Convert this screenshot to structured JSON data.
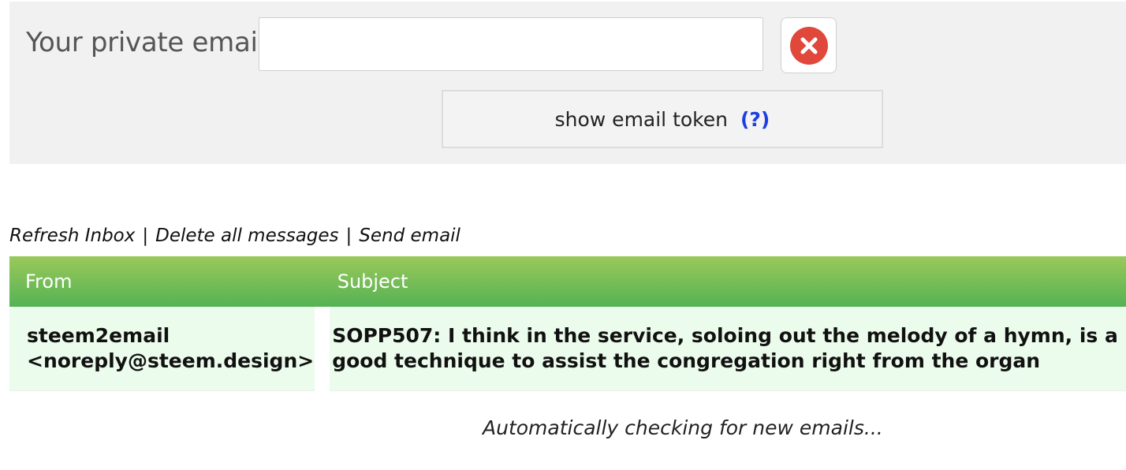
{
  "email_panel": {
    "label": "Your private email",
    "email_value": "",
    "email_placeholder": "",
    "token_button_label": "show email token",
    "token_help_label": "(?)"
  },
  "inbox_actions": {
    "refresh": "Refresh Inbox",
    "separator": "|",
    "delete_all": "Delete all messages",
    "send": "Send email"
  },
  "inbox": {
    "columns": [
      "From",
      "Subject"
    ],
    "rows": [
      {
        "from_name": "steem2email",
        "from_address": "<noreply@steem.design>",
        "subject": "SOPP507: I think in the service, soloing out the melody of a hymn, is a good technique to assist the congregation right from the organ"
      }
    ]
  },
  "status": "Automatically checking for new emails...",
  "colors": {
    "header_gradient_top": "#9bc95a",
    "header_gradient_bottom": "#55b254",
    "row_bg": "#ecfcec",
    "clear_icon": "#e0483b",
    "help_link": "#1d3fe0"
  },
  "icons": {
    "clear": "close-circle-icon"
  }
}
